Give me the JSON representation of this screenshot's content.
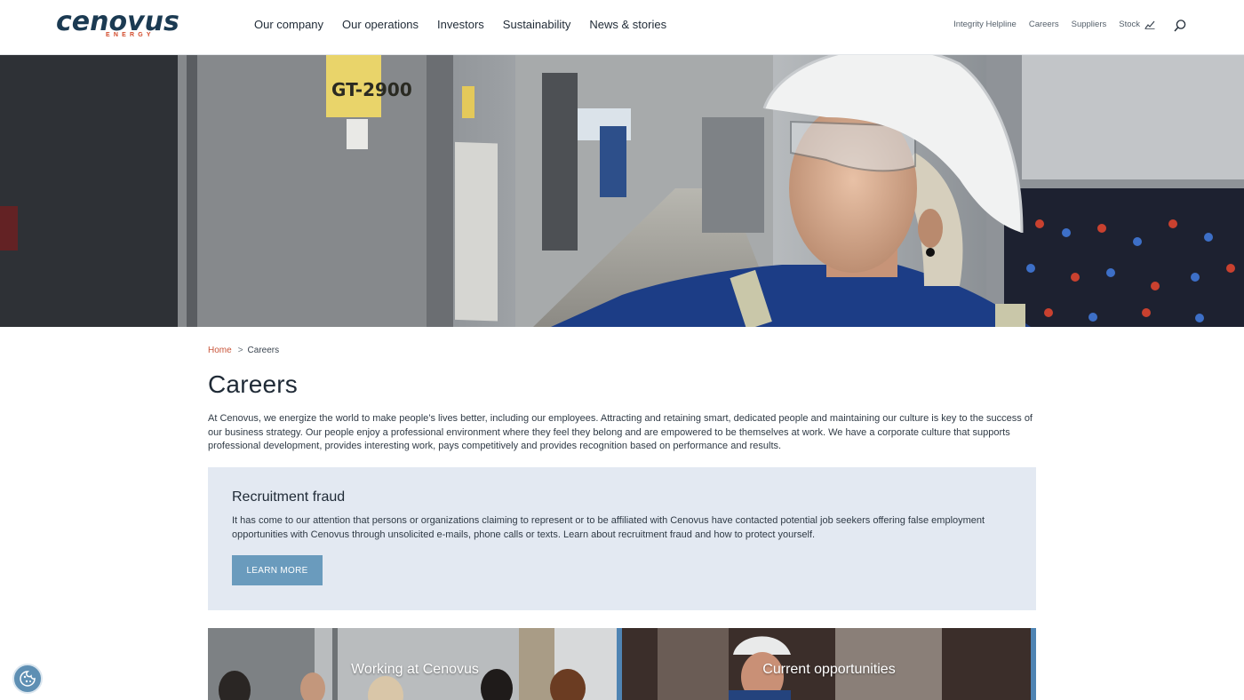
{
  "brand": {
    "name": "cenovus",
    "tagline": "ENERGY"
  },
  "main_nav": [
    "Our company",
    "Our operations",
    "Investors",
    "Sustainability",
    "News & stories"
  ],
  "util_nav": {
    "integrity": "Integrity Helpline",
    "careers": "Careers",
    "suppliers": "Suppliers",
    "stock": "Stock"
  },
  "hero": {
    "sign_text": "GT-2900"
  },
  "breadcrumb": {
    "home": "Home",
    "separator": ">",
    "current": "Careers"
  },
  "page": {
    "title": "Careers",
    "intro": "At Cenovus, we energize the world to make people’s lives better, including our employees. Attracting and retaining smart, dedicated people and maintaining our culture is key to the success of our business strategy. Our people enjoy a professional environment where they feel they belong and are empowered to be themselves at work. We have a corporate culture that supports professional development, provides interesting work, pays competitively and provides recognition based on performance and results."
  },
  "fraud": {
    "title": "Recruitment fraud",
    "text": "It has come to our attention that persons or organizations claiming to represent or to be affiliated with Cenovus have contacted potential job seekers offering false employment opportunities with Cenovus through unsolicited e-mails, phone calls or texts. Learn about recruitment fraud and how to protect yourself.",
    "button": "LEARN MORE"
  },
  "cards": [
    {
      "title": "Working at Cenovus"
    },
    {
      "title": "Current opportunities"
    }
  ],
  "colors": {
    "accent": "#6a9bbd",
    "brand_navy": "#1b3a52",
    "brand_red": "#d2492a",
    "panel": "#e3e9f2"
  },
  "icons": {
    "stock": "chart-line-icon",
    "search": "search-icon",
    "cookie": "cookie-icon"
  }
}
